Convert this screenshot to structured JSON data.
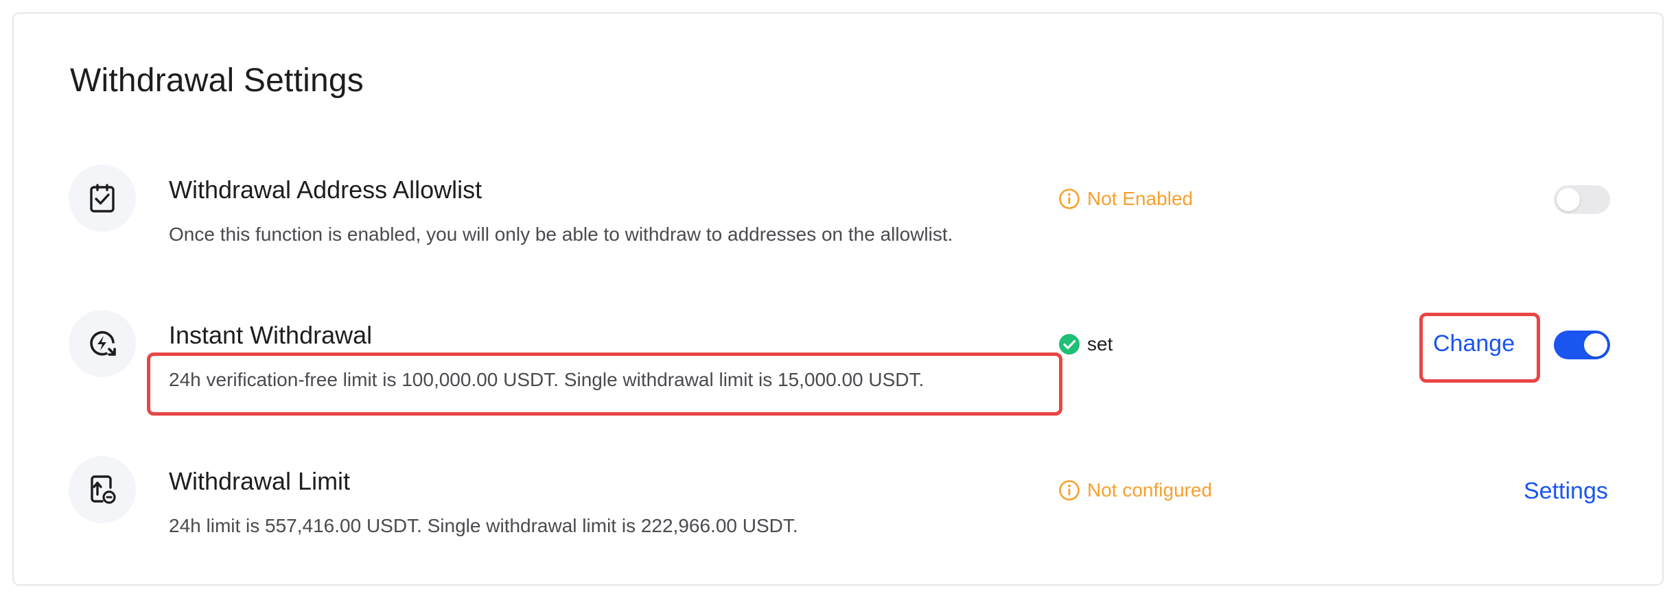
{
  "page": {
    "title": "Withdrawal Settings"
  },
  "rows": [
    {
      "title": "Withdrawal Address Allowlist",
      "description": "Once this function is enabled, you will only be able to withdraw to addresses on the allowlist.",
      "icon": "clipboard-check-icon",
      "status": {
        "label": "Not Enabled",
        "type": "warning"
      },
      "toggle": {
        "enabled": false
      }
    },
    {
      "title": "Instant Withdrawal",
      "description": "24h verification-free limit is 100,000.00 USDT. Single withdrawal limit is 15,000.00 USDT.",
      "icon": "instant-bolt-icon",
      "status": {
        "label": "set",
        "type": "success"
      },
      "action_label": "Change",
      "toggle": {
        "enabled": true
      }
    },
    {
      "title": "Withdrawal Limit",
      "description": "24h limit is 557,416.00 USDT. Single withdrawal limit is 222,966.00 USDT.",
      "icon": "limit-upload-icon",
      "status": {
        "label": "Not configured",
        "type": "warning"
      },
      "action_label": "Settings"
    }
  ],
  "colors": {
    "accent": "#1a55f0",
    "warning": "#f7a02d",
    "success": "#1fbf75",
    "highlight": "#e84646"
  }
}
